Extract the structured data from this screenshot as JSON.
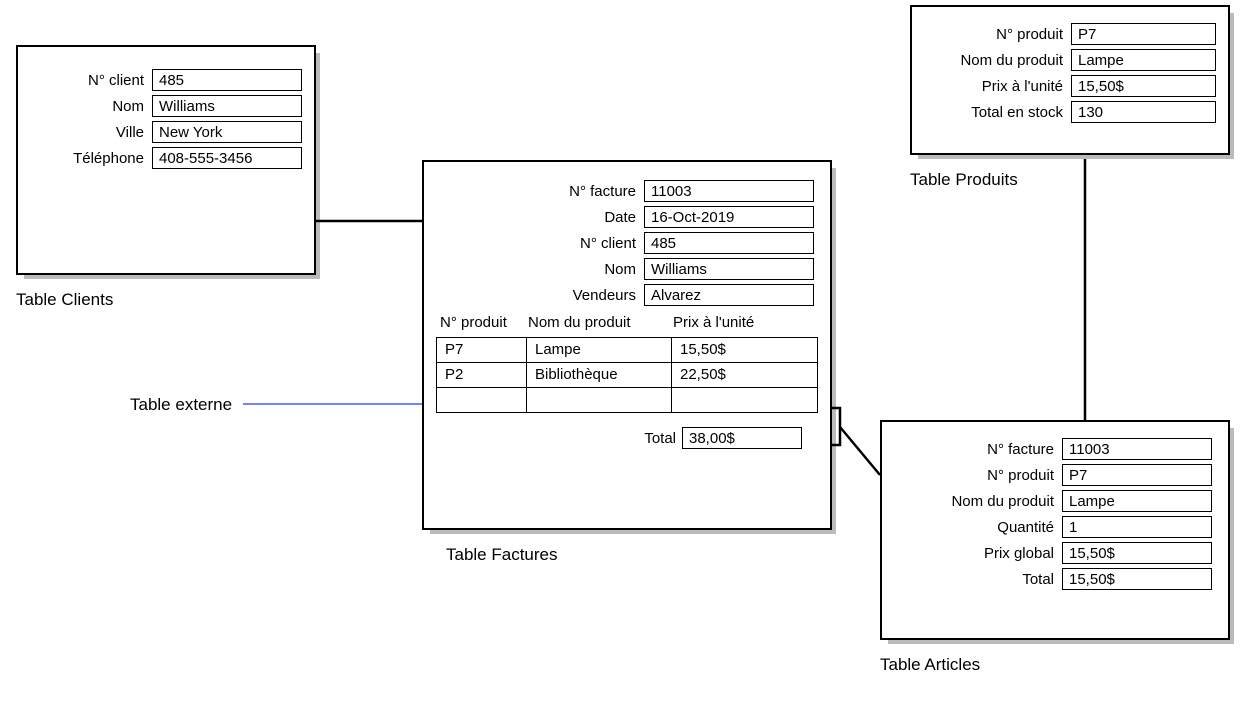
{
  "clients": {
    "caption": "Table Clients",
    "fields": {
      "num_client_label": "N° client",
      "num_client": "485",
      "nom_label": "Nom",
      "nom": "Williams",
      "ville_label": "Ville",
      "ville": "New York",
      "tel_label": "Téléphone",
      "tel": "408-555-3456"
    }
  },
  "produits": {
    "caption": "Table Produits",
    "fields": {
      "num_label": "N° produit",
      "num": "P7",
      "nom_label": "Nom du produit",
      "nom": "Lampe",
      "prix_label": "Prix à l'unité",
      "prix": "15,50$",
      "stock_label": "Total en stock",
      "stock": "130"
    }
  },
  "factures": {
    "caption": "Table Factures",
    "fields": {
      "num_label": "N° facture",
      "num": "11003",
      "date_label": "Date",
      "date": "16-Oct-2019",
      "client_label": "N° client",
      "client": "485",
      "nom_label": "Nom",
      "nom": "Williams",
      "vendeurs_label": "Vendeurs",
      "vendeurs": "Alvarez",
      "total_label": "Total",
      "total": "38,00$"
    },
    "portal_headers": {
      "c1": "N° produit",
      "c2": "Nom du produit",
      "c3": "Prix à l'unité"
    },
    "portal_rows": [
      {
        "c1": "P7",
        "c2": "Lampe",
        "c3": "15,50$"
      },
      {
        "c1": "P2",
        "c2": "Bibliothèque",
        "c3": "22,50$"
      },
      {
        "c1": "",
        "c2": "",
        "c3": ""
      }
    ]
  },
  "articles": {
    "caption": "Table Articles",
    "fields": {
      "facture_label": "N° facture",
      "facture": "11003",
      "produit_label": "N° produit",
      "produit": "P7",
      "nom_label": "Nom du produit",
      "nom": "Lampe",
      "qte_label": "Quantité",
      "qte": "1",
      "prix_label": "Prix global",
      "prix": "15,50$",
      "total_label": "Total",
      "total": "15,50$"
    }
  },
  "extern_label": "Table externe"
}
